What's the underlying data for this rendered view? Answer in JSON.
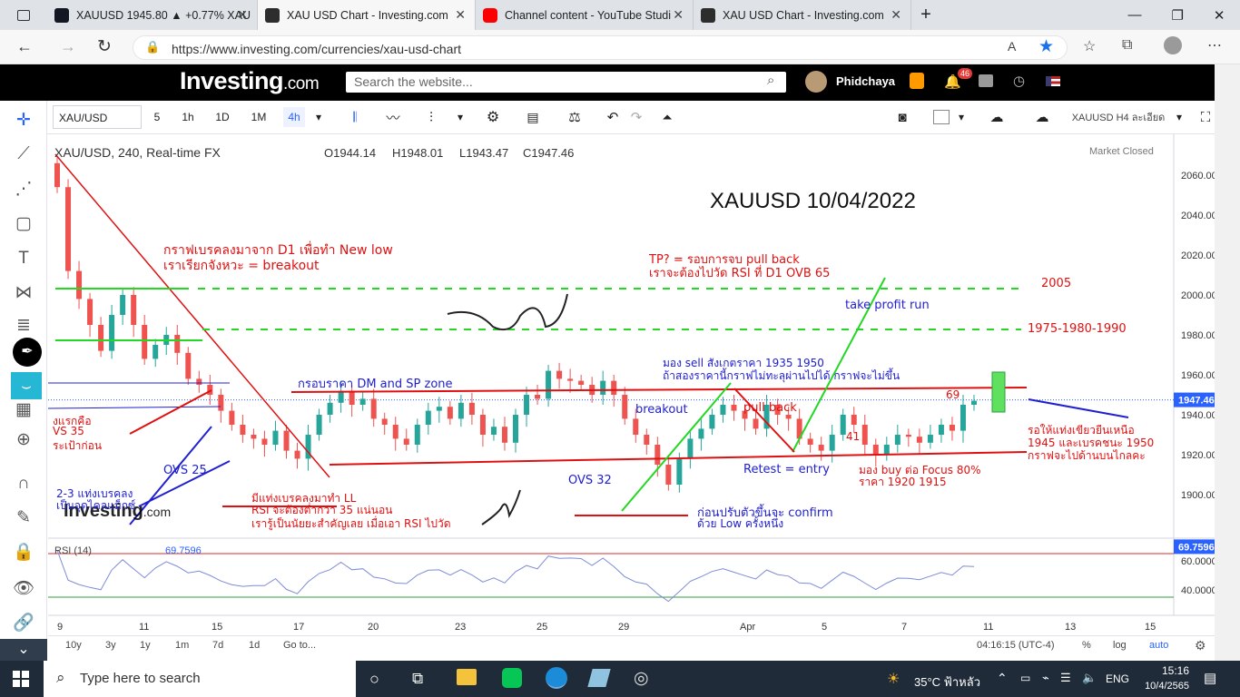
{
  "browser": {
    "tabs": [
      {
        "label": "XAUUSD 1945.80 ▲ +0.77% XAU",
        "color": "#131722"
      },
      {
        "label": "XAU USD Chart - Investing.com",
        "color": "#2d2d2d"
      },
      {
        "label": "Channel content - YouTube Studi",
        "color": "#ff0000"
      },
      {
        "label": "XAU USD Chart - Investing.com",
        "color": "#2d2d2d"
      }
    ],
    "url": "https://www.investing.com/currencies/xau-usd-chart",
    "new_tab": "+"
  },
  "site": {
    "logo": "Investing",
    "logo_suffix": ".com",
    "search_placeholder": "Search the website...",
    "user": "Phidchaya",
    "notif_count": "46"
  },
  "toolbar": {
    "symbol": "XAU/USD",
    "intervals": [
      "5",
      "1h",
      "1D",
      "1M",
      "4h"
    ],
    "layout": "XAUUSD H4 ละเอียด"
  },
  "legend": {
    "title": "XAU/USD, 240, Real-time FX",
    "o": "O1944.14",
    "h": "H1948.01",
    "l": "L1943.47",
    "c": "C1947.46",
    "status": "Market Closed"
  },
  "chart_data": {
    "type": "candlestick",
    "title": "XAUUSD 10/04/2022",
    "y_ticks": [
      "2060.00",
      "2040.00",
      "2020.00",
      "2000.00",
      "1980.00",
      "1960.00",
      "1940.00",
      "1920.00",
      "1900.00"
    ],
    "last_price": "1947.46",
    "x_ticks": [
      "9",
      "11",
      "15",
      "17",
      "20",
      "23",
      "25",
      "29",
      "Apr",
      "5",
      "7",
      "11",
      "13",
      "15"
    ],
    "rsi": {
      "label": "RSI (14)",
      "value": "69.7596",
      "ticks": [
        "60.0000",
        "40.0000"
      ]
    },
    "closes": [
      2054,
      2012,
      1998,
      1985,
      1972,
      1990,
      2000,
      1985,
      1968,
      1975,
      1980,
      1971,
      1958,
      1955,
      1950,
      1942,
      1935,
      1930,
      1928,
      1925,
      1932,
      1922,
      1918,
      1930,
      1940,
      1946,
      1952,
      1945,
      1948,
      1938,
      1935,
      1928,
      1925,
      1935,
      1942,
      1944,
      1938,
      1946,
      1940,
      1930,
      1934,
      1926,
      1940,
      1950,
      1948,
      1962,
      1958,
      1957,
      1955,
      1950,
      1957,
      1950,
      1938,
      1930,
      1925,
      1915,
      1905,
      1918,
      1928,
      1933,
      1940,
      1945,
      1942,
      1938,
      1933,
      1945,
      1940,
      1938,
      1928,
      1925,
      1922,
      1930,
      1940,
      1935,
      1925,
      1920,
      1925,
      1930,
      1929,
      1926,
      1930,
      1935,
      1932,
      1945,
      1947
    ]
  },
  "annotations": [
    {
      "text": "กราฟเบรคลงมาจาก D1 เพื่อทำ New low",
      "color": "#e01010"
    },
    {
      "text": "เราเรียกจังหวะ = breakout",
      "color": "#e01010"
    },
    {
      "text": "TP? = รอบการจบ pull back",
      "color": "#e01010"
    },
    {
      "text": "เราจะต้องไปวัด RSI ที่ D1 OVB 65",
      "color": "#e01010"
    },
    {
      "text": "2005",
      "color": "#e01010"
    },
    {
      "text": "1975-1980-1990",
      "color": "#e01010"
    },
    {
      "text": "take profit run",
      "color": "#2020d0"
    },
    {
      "text": "กรอบราคา DM and SP zone",
      "color": "#2020d0"
    },
    {
      "text": "มอง sell สังเกตราคา 1935 1950",
      "color": "#2020d0"
    },
    {
      "text": "ถ้าสองราคานี้กราฟไม่ทะลุผ่านไปได้ กราฟจะไม่ขึ้น",
      "color": "#2020d0"
    },
    {
      "text": "breakout",
      "color": "#2020d0"
    },
    {
      "text": "pull back",
      "color": "#e01010"
    },
    {
      "text": "69",
      "color": "#e01010"
    },
    {
      "text": "41",
      "color": "#e01010"
    },
    {
      "text": "Retest = entry",
      "color": "#2020d0"
    },
    {
      "text": "มอง buy ต่อ Focus 80%",
      "color": "#e01010"
    },
    {
      "text": "ราคา 1920 1915",
      "color": "#e01010"
    },
    {
      "text": "OVS 32",
      "color": "#2020d0"
    },
    {
      "text": "OVS 25",
      "color": "#2020d0"
    },
    {
      "text": "ก่อนปรับตัวขึ้นจะ confirm",
      "color": "#2020d0"
    },
    {
      "text": "ด้วย Low ครั้งหนึ่ง",
      "color": "#2020d0"
    },
    {
      "text": "มีแท่งเบรคลงมาทำ LL",
      "color": "#e01010"
    },
    {
      "text": "RSI จะต้องต่ำกว่า 35 แน่นอน",
      "color": "#e01010"
    },
    {
      "text": "เรารู้เป็นนัยยะสำคัญเลย เมื่อเอา RSI ไปวัด",
      "color": "#e01010"
    },
    {
      "text": "รอให้แท่งเขียวยืนเหนือ",
      "color": "#e01010"
    },
    {
      "text": "1945 และเบรคชนะ 1950",
      "color": "#e01010"
    },
    {
      "text": "กราฟจะไปด้านบนไกลคะ",
      "color": "#e01010"
    },
    {
      "text": "งแรกคือ",
      "color": "#e01010"
    },
    {
      "text": "VS 35",
      "color": "#e01010"
    },
    {
      "text": "ระเป้าก่อน",
      "color": "#e01010"
    },
    {
      "text": "2-3 แท่งเบรคลง",
      "color": "#2020d0"
    },
    {
      "text": "เป็นจุดไคลแม็กซ์",
      "color": "#2020d0"
    }
  ],
  "bottom": {
    "ranges": [
      "10y",
      "3y",
      "1y",
      "1m",
      "7d",
      "1d",
      "Go to..."
    ],
    "time": "04:16:15 (UTC-4)",
    "opts": [
      "%",
      "log",
      "auto"
    ]
  },
  "taskbar": {
    "search": "Type here to search",
    "weather": "35°C ฟ้าหลัว",
    "lang": "ENG",
    "time": "15:16",
    "date": "10/4/2565"
  }
}
